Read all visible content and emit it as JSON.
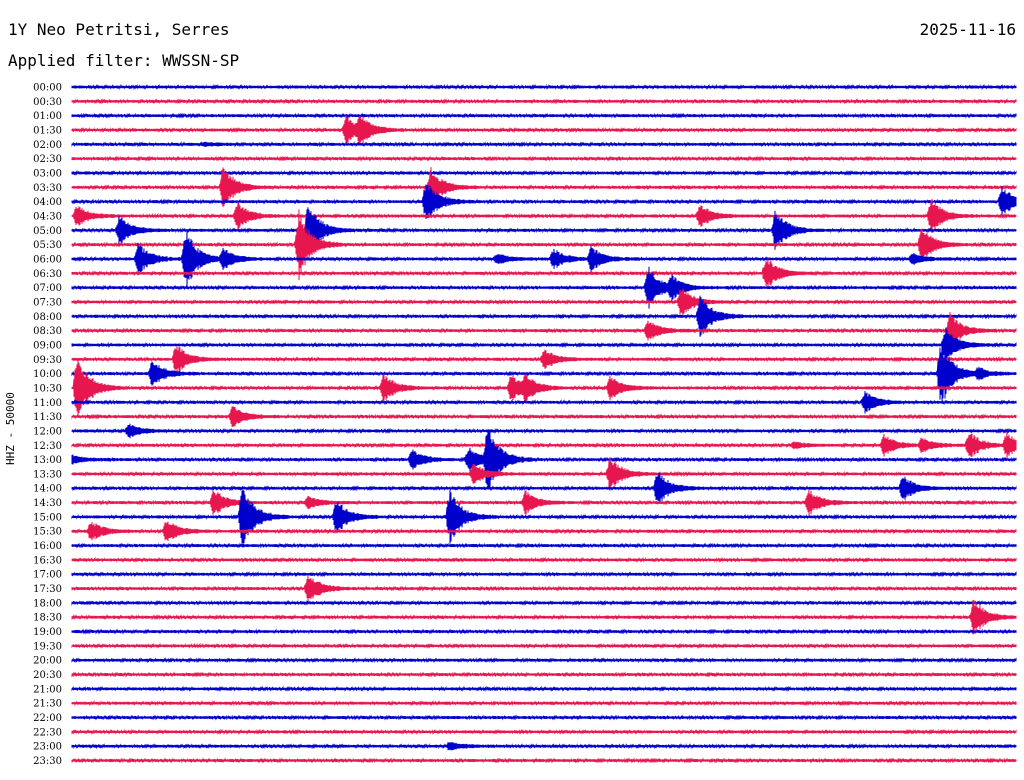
{
  "header": {
    "station": "1Y Neo Petritsi, Serres",
    "date": "2025-11-16",
    "filter": "Applied filter: WWSSN-SP"
  },
  "chart_data": {
    "type": "line",
    "title": "1Y Neo Petritsi, Serres",
    "ylabel": "HHZ - 50000",
    "y_tick_labels": [
      "00:00",
      "00:30",
      "01:00",
      "01:30",
      "02:00",
      "02:30",
      "03:00",
      "03:30",
      "04:00",
      "04:30",
      "05:00",
      "05:30",
      "06:00",
      "06:30",
      "07:00",
      "07:30",
      "08:00",
      "08:30",
      "09:00",
      "09:30",
      "10:00",
      "10:30",
      "11:00",
      "11:30",
      "12:00",
      "12:30",
      "13:00",
      "13:30",
      "14:00",
      "14:30",
      "15:00",
      "15:30",
      "16:00",
      "16:30",
      "17:00",
      "17:30",
      "18:00",
      "18:30",
      "19:00",
      "19:30",
      "20:00",
      "20:30",
      "21:00",
      "21:30",
      "22:00",
      "22:30",
      "23:00",
      "23:30"
    ],
    "trace_colors": [
      "#0000cc",
      "#e8164f"
    ],
    "x_range_minutes": [
      0,
      30
    ],
    "events": [
      {
        "trace": "01:30",
        "t": 0.29,
        "amp": 1.6
      },
      {
        "trace": "01:30",
        "t": 0.305,
        "amp": 1.5
      },
      {
        "trace": "02:00",
        "t": 0.14,
        "amp": 0.2
      },
      {
        "trace": "03:30",
        "t": 0.16,
        "amp": 2.5
      },
      {
        "trace": "03:30",
        "t": 0.38,
        "amp": 2.2
      },
      {
        "trace": "04:00",
        "t": 0.375,
        "amp": 2.5
      },
      {
        "trace": "04:00",
        "t": 0.985,
        "amp": 1.8
      },
      {
        "trace": "04:30",
        "t": 0.005,
        "amp": 1.2
      },
      {
        "trace": "04:30",
        "t": 0.175,
        "amp": 1.6
      },
      {
        "trace": "04:30",
        "t": 0.665,
        "amp": 1.4
      },
      {
        "trace": "04:30",
        "t": 0.91,
        "amp": 2.0
      },
      {
        "trace": "05:00",
        "t": 0.05,
        "amp": 1.8
      },
      {
        "trace": "05:00",
        "t": 0.25,
        "amp": 3.2
      },
      {
        "trace": "05:00",
        "t": 0.745,
        "amp": 2.4
      },
      {
        "trace": "05:30",
        "t": 0.24,
        "amp": 4.0
      },
      {
        "trace": "05:30",
        "t": 0.9,
        "amp": 2.0
      },
      {
        "trace": "06:00",
        "t": 0.07,
        "amp": 1.8
      },
      {
        "trace": "06:00",
        "t": 0.12,
        "amp": 3.5
      },
      {
        "trace": "06:00",
        "t": 0.16,
        "amp": 1.2
      },
      {
        "trace": "06:00",
        "t": 0.45,
        "amp": 0.6
      },
      {
        "trace": "06:00",
        "t": 0.51,
        "amp": 1.2
      },
      {
        "trace": "06:00",
        "t": 0.55,
        "amp": 1.4
      },
      {
        "trace": "06:00",
        "t": 0.89,
        "amp": 0.6
      },
      {
        "trace": "06:30",
        "t": 0.735,
        "amp": 2.0
      },
      {
        "trace": "07:00",
        "t": 0.61,
        "amp": 2.5
      },
      {
        "trace": "07:00",
        "t": 0.635,
        "amp": 1.2
      },
      {
        "trace": "07:30",
        "t": 0.645,
        "amp": 1.8
      },
      {
        "trace": "08:00",
        "t": 0.665,
        "amp": 2.6
      },
      {
        "trace": "08:30",
        "t": 0.61,
        "amp": 1.2
      },
      {
        "trace": "08:30",
        "t": 0.93,
        "amp": 2.0
      },
      {
        "trace": "09:00",
        "t": 0.925,
        "amp": 2.0
      },
      {
        "trace": "09:30",
        "t": 0.11,
        "amp": 1.8
      },
      {
        "trace": "09:30",
        "t": 0.5,
        "amp": 1.2
      },
      {
        "trace": "10:00",
        "t": 0.085,
        "amp": 1.6
      },
      {
        "trace": "10:00",
        "t": 0.92,
        "amp": 4.0
      },
      {
        "trace": "10:00",
        "t": 0.96,
        "amp": 0.6
      },
      {
        "trace": "10:30",
        "t": 0.005,
        "amp": 4.0
      },
      {
        "trace": "10:30",
        "t": 0.33,
        "amp": 1.6
      },
      {
        "trace": "10:30",
        "t": 0.465,
        "amp": 1.6
      },
      {
        "trace": "10:30",
        "t": 0.48,
        "amp": 1.2
      },
      {
        "trace": "10:30",
        "t": 0.57,
        "amp": 1.4
      },
      {
        "trace": "11:00",
        "t": 0.84,
        "amp": 1.2
      },
      {
        "trace": "11:30",
        "t": 0.17,
        "amp": 1.2
      },
      {
        "trace": "12:00",
        "t": 0.06,
        "amp": 0.8
      },
      {
        "trace": "12:30",
        "t": 0.765,
        "amp": 0.4
      },
      {
        "trace": "12:30",
        "t": 0.86,
        "amp": 1.2
      },
      {
        "trace": "12:30",
        "t": 0.9,
        "amp": 0.8
      },
      {
        "trace": "12:30",
        "t": 0.95,
        "amp": 1.6
      },
      {
        "trace": "12:30",
        "t": 0.99,
        "amp": 1.4
      },
      {
        "trace": "13:00",
        "t": 0.0,
        "amp": 0.5
      },
      {
        "trace": "13:00",
        "t": 0.36,
        "amp": 1.2
      },
      {
        "trace": "13:00",
        "t": 0.42,
        "amp": 1.6
      },
      {
        "trace": "13:00",
        "t": 0.44,
        "amp": 4.0
      },
      {
        "trace": "13:30",
        "t": 0.425,
        "amp": 1.2
      },
      {
        "trace": "13:30",
        "t": 0.57,
        "amp": 2.0
      },
      {
        "trace": "14:00",
        "t": 0.62,
        "amp": 2.0
      },
      {
        "trace": "14:00",
        "t": 0.88,
        "amp": 1.5
      },
      {
        "trace": "14:30",
        "t": 0.15,
        "amp": 1.6
      },
      {
        "trace": "14:30",
        "t": 0.25,
        "amp": 0.8
      },
      {
        "trace": "14:30",
        "t": 0.48,
        "amp": 1.4
      },
      {
        "trace": "14:30",
        "t": 0.78,
        "amp": 1.6
      },
      {
        "trace": "15:00",
        "t": 0.18,
        "amp": 4.0
      },
      {
        "trace": "15:00",
        "t": 0.28,
        "amp": 2.0
      },
      {
        "trace": "15:00",
        "t": 0.4,
        "amp": 3.2
      },
      {
        "trace": "15:30",
        "t": 0.02,
        "amp": 1.2
      },
      {
        "trace": "15:30",
        "t": 0.1,
        "amp": 1.4
      },
      {
        "trace": "17:30",
        "t": 0.25,
        "amp": 1.8
      },
      {
        "trace": "18:30",
        "t": 0.955,
        "amp": 2.2
      },
      {
        "trace": "23:00",
        "t": 0.4,
        "amp": 0.5
      }
    ]
  }
}
